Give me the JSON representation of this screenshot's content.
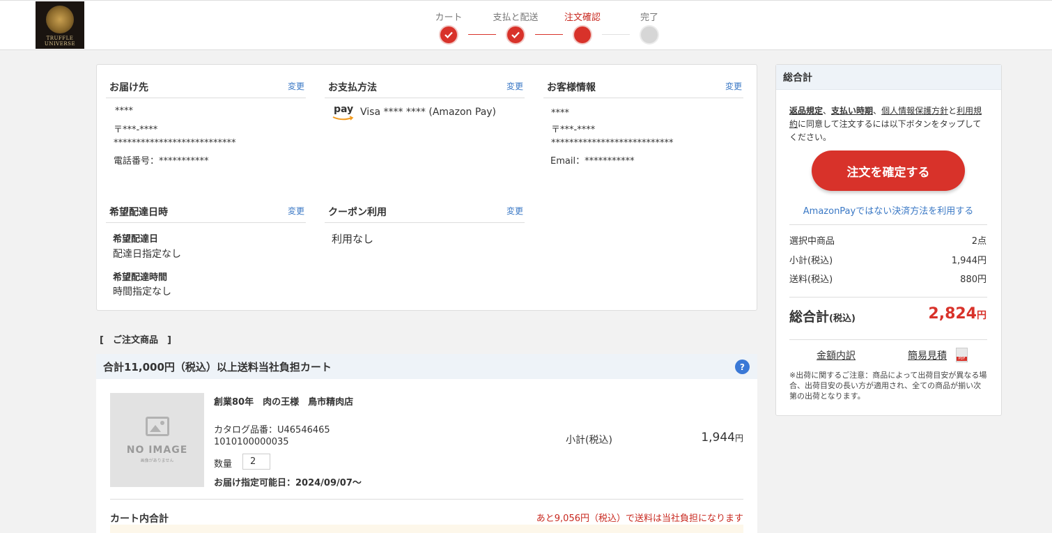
{
  "header": {
    "logo_line1": "TRUFFLE",
    "logo_line2": "UNIVERSE",
    "steps": [
      {
        "label": "カート",
        "state": "done"
      },
      {
        "label": "支払と配送",
        "state": "done"
      },
      {
        "label": "注文確認",
        "state": "current"
      },
      {
        "label": "完了",
        "state": "todo"
      }
    ]
  },
  "shipping": {
    "title": "お届け先",
    "change": "変更",
    "name": "****",
    "postal": "〒***-****",
    "address": "***************************",
    "phone": "電話番号：***********"
  },
  "payment": {
    "title": "お支払方法",
    "change": "変更",
    "pay_logo": "pay",
    "method": "Visa **** **** (Amazon Pay)"
  },
  "customer": {
    "title": "お客様情報",
    "change": "変更",
    "name": "****",
    "postal": "〒***-****",
    "address": "***************************",
    "email": "Email：***********"
  },
  "delivery": {
    "title": "希望配達日時",
    "change": "変更",
    "date_label": "希望配達日",
    "date_value": "配達日指定なし",
    "time_label": "希望配達時間",
    "time_value": "時間指定なし"
  },
  "coupon": {
    "title": "クーポン利用",
    "change": "変更",
    "value": "利用なし"
  },
  "summary": {
    "title": "総合計",
    "terms_1": "返品規定",
    "terms_sep1": "、",
    "terms_2": "支払い時期",
    "terms_sep2": "、",
    "terms_3": "個人情報保護方針",
    "terms_sep3": "と",
    "terms_4": "利用規約",
    "terms_rest": "に同意して注文するには以下ボタンをタップしてください。",
    "confirm_button": "注文を確定する",
    "alt_payment": "AmazonPayではない決済方法を利用する",
    "items_label": "選択中商品",
    "items_value": "2点",
    "subtotal_label": "小計(税込)",
    "subtotal_value": "1,944円",
    "shipping_label": "送料(税込)",
    "shipping_value": "880円",
    "grand_label": "総合計",
    "grand_label_small": "(税込)",
    "grand_value": "2,824",
    "grand_unit": "円",
    "breakdown_link": "金額内訳",
    "estimate_link": "簡易見積",
    "note": "※出荷に関するご注意：商品によって出荷目安が異なる場合、出荷目安の長い方が適用され、全ての商品が揃い次第の出荷となります。"
  },
  "order": {
    "section_title": "[　ご注文商品　]",
    "cart_title": "合計11,000円（税込）以上送料当社負担カート",
    "help": "?",
    "item": {
      "noimage_title": "NO IMAGE",
      "noimage_sub": "画像がありません",
      "name": "創業80年　肉の王様　鳥市精肉店",
      "catalog": "カタログ品番：U46546465",
      "code": "1010100000035",
      "qty_label": "数量",
      "qty_value": "2",
      "available_date": "お届け指定可能日：2024/09/07〜",
      "subtotal_label": "小計(税込)",
      "price": "1,944",
      "price_unit": "円"
    },
    "cart_total_label": "カート内合計",
    "free_shipping_note": "あと9,056円（税込）で送料は当社負担になります"
  }
}
